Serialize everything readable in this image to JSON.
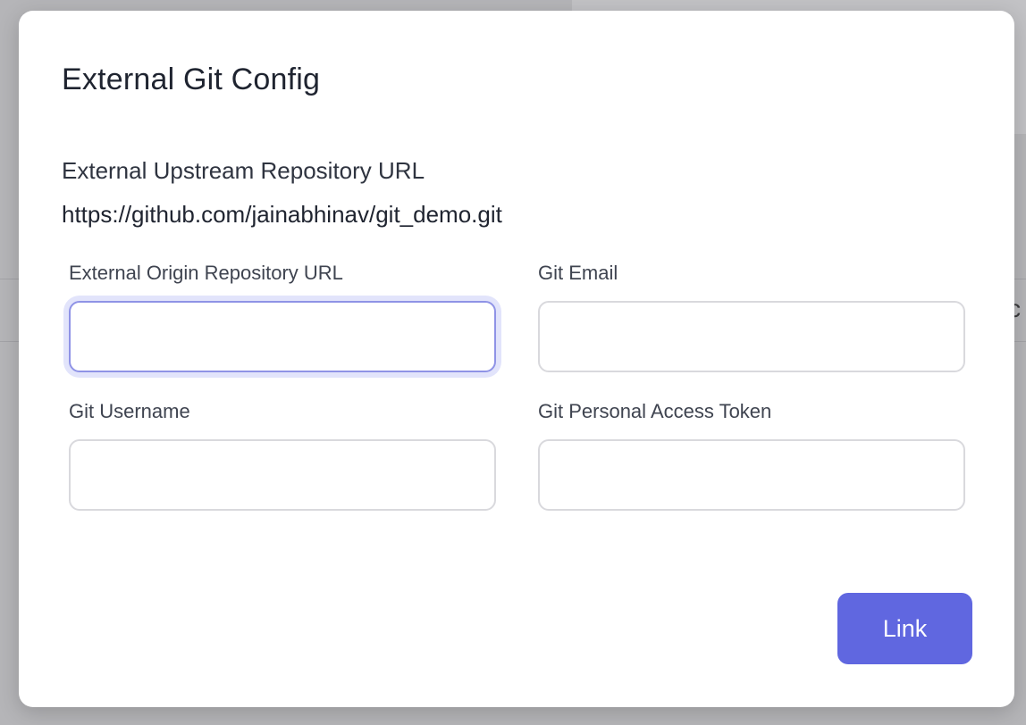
{
  "backdrop": {
    "partial_text": "c"
  },
  "modal": {
    "title": "External Git Config",
    "upstream": {
      "label": "External Upstream Repository URL",
      "value": "https://github.com/jainabhinav/git_demo.git"
    },
    "fields": {
      "origin_url": {
        "label": "External Origin Repository URL",
        "value": "",
        "placeholder": ""
      },
      "git_email": {
        "label": "Git Email",
        "value": "",
        "placeholder": ""
      },
      "git_username": {
        "label": "Git Username",
        "value": "",
        "placeholder": ""
      },
      "git_token": {
        "label": "Git Personal Access Token",
        "value": "",
        "placeholder": ""
      }
    },
    "link_button": "Link"
  },
  "colors": {
    "accent": "#6067e0",
    "focus_ring": "#e2e4fb",
    "backdrop": "#b5b5b8"
  }
}
